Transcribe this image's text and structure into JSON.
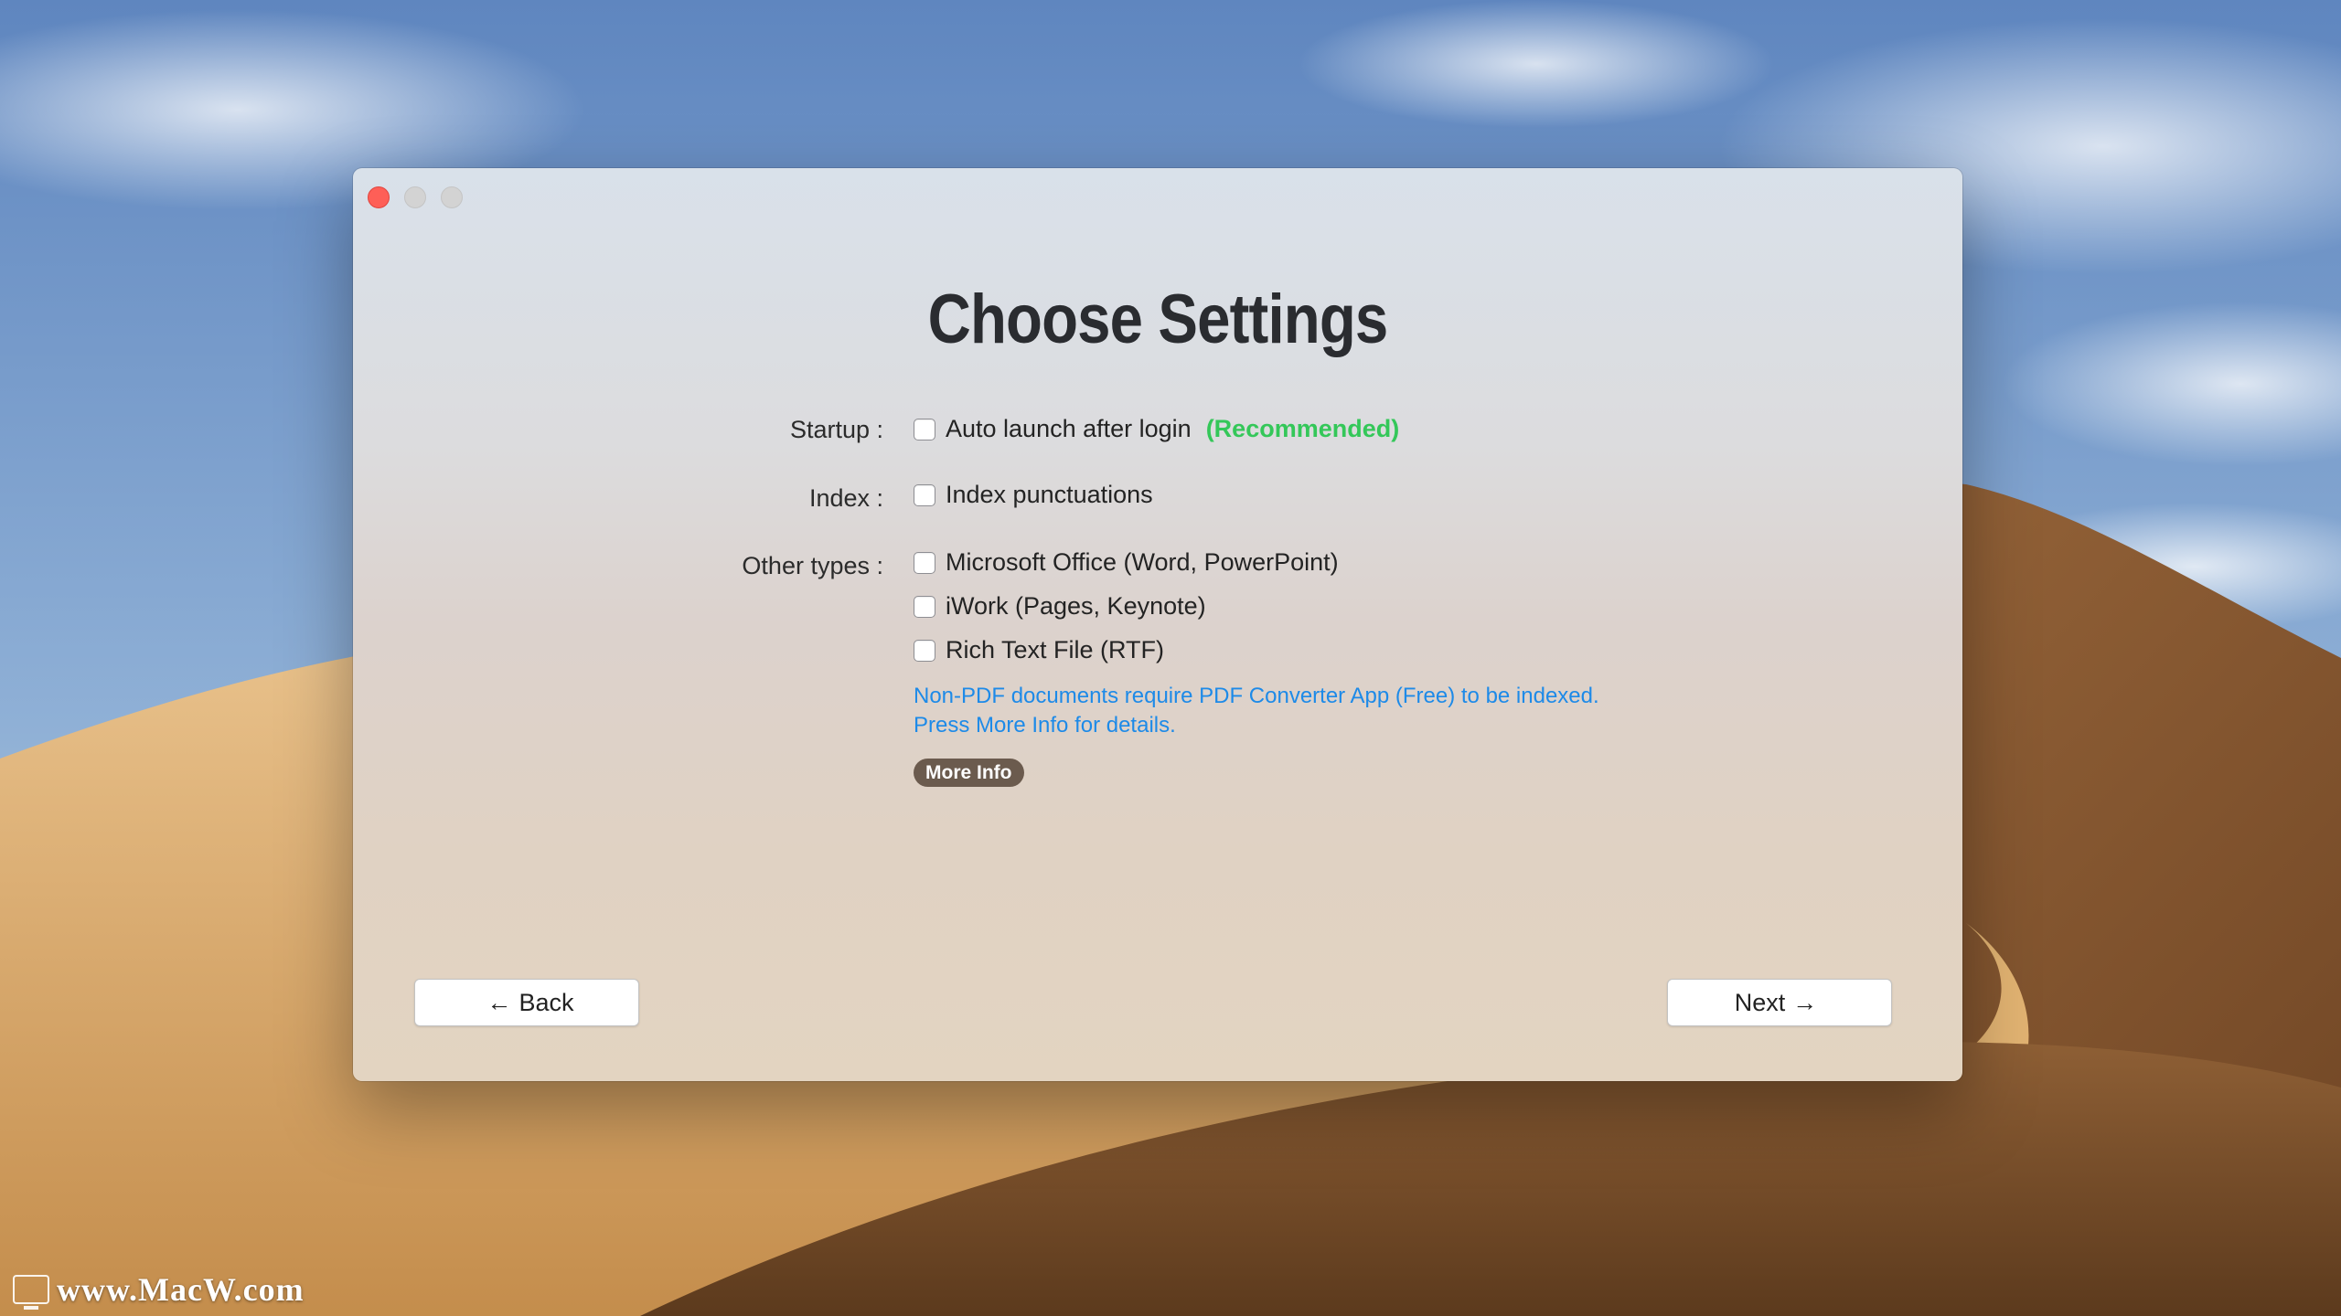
{
  "window": {
    "title": "Choose Settings",
    "controls": [
      "close",
      "minimize",
      "zoom"
    ]
  },
  "settings": {
    "startup": {
      "label": "Startup :",
      "option": "Auto launch after login",
      "badge": "(Recommended)",
      "checked": false
    },
    "index": {
      "label": "Index :",
      "option": "Index punctuations",
      "checked": false
    },
    "other_types": {
      "label": "Other types :",
      "options": [
        {
          "label": "Microsoft Office (Word, PowerPoint)",
          "checked": false
        },
        {
          "label": "iWork (Pages, Keynote)",
          "checked": false
        },
        {
          "label": "Rich Text File (RTF)",
          "checked": false
        }
      ],
      "note_line1": "Non-PDF documents require PDF Converter App (Free) to be indexed.",
      "note_line2": "Press More Info for details.",
      "more_info_label": "More Info"
    }
  },
  "navigation": {
    "back_arrow": "←",
    "back_label": "Back",
    "next_label": "Next",
    "next_arrow": "→"
  },
  "watermark": "www.MacW.com",
  "colors": {
    "recommended": "#34c759",
    "note": "#1d8ae8",
    "more_info_bg": "#6b5b4e",
    "close_button": "#fe5f57"
  },
  "icons": [
    "checkbox-icon",
    "arrow-left-icon",
    "arrow-right-icon",
    "watermark-logo-icon"
  ]
}
